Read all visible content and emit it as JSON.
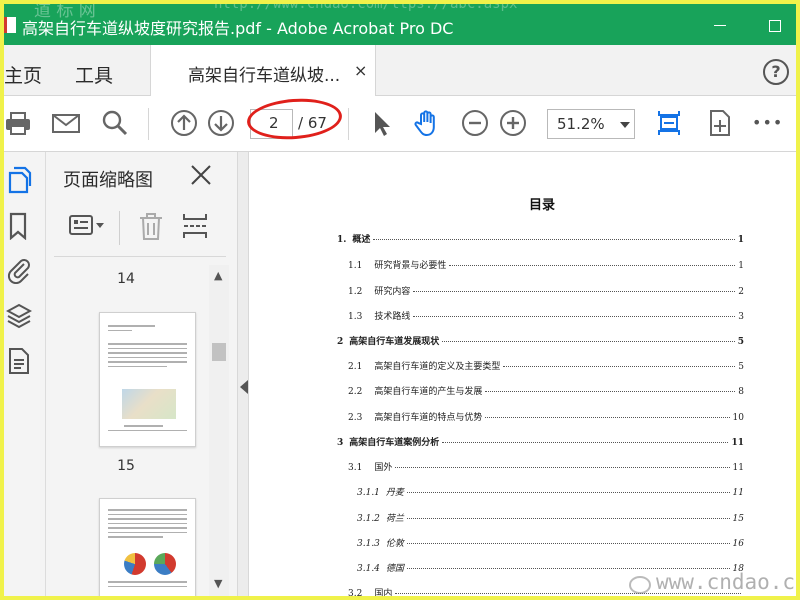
{
  "window": {
    "title": "高架自行车道纵坡度研究报告.pdf - Adobe Acrobat Pro DC",
    "watermark_top": "道 标 网",
    "watermark_top_url": "http://www.cndao.com/ttps://abc.aspx",
    "titlebar_color": "#18a35a"
  },
  "tabs": {
    "home": "主页",
    "tools": "工具",
    "document": "高架自行车道纵坡...",
    "close": "×"
  },
  "help": {
    "label": "?"
  },
  "toolbar": {
    "page_current": "2",
    "page_total": "/ 67",
    "zoom": "51.2%",
    "icons": [
      "print-icon",
      "email-icon",
      "search-icon",
      "previous-page-icon",
      "next-page-icon",
      "select-arrow-icon",
      "hand-tool-icon",
      "zoom-out-icon",
      "zoom-in-icon",
      "fit-page-icon",
      "scroll-mode-icon",
      "more-icon"
    ],
    "more_label": "•••",
    "accent": "#1473e6",
    "highlight_color": "#e0201b"
  },
  "rail": {
    "icons": [
      "page-thumbnails-icon",
      "bookmarks-icon",
      "attachments-icon",
      "layers-icon",
      "document-info-icon"
    ]
  },
  "thumbnails_panel": {
    "title": "页面缩略图",
    "close": "✕",
    "icons": [
      "thumbnail-options-icon",
      "delete-page-icon",
      "insert-page-icon"
    ],
    "pages": [
      {
        "label": "14"
      },
      {
        "label": "15"
      }
    ]
  },
  "document": {
    "toc_title": "目录",
    "toc": [
      {
        "num": "1.",
        "text": "概述",
        "page": "1",
        "level": 1
      },
      {
        "num": "1.1",
        "text": "研究背景与必要性",
        "page": "1",
        "level": 2
      },
      {
        "num": "1.2",
        "text": "研究内容",
        "page": "2",
        "level": 2
      },
      {
        "num": "1.3",
        "text": "技术路线",
        "page": "3",
        "level": 2
      },
      {
        "num": "2",
        "text": "高架自行车道发展现状",
        "page": "5",
        "level": 1
      },
      {
        "num": "2.1",
        "text": "高架自行车道的定义及主要类型",
        "page": "5",
        "level": 2
      },
      {
        "num": "2.2",
        "text": "高架自行车道的产生与发展",
        "page": "8",
        "level": 2
      },
      {
        "num": "2.3",
        "text": "高架自行车道的特点与优势",
        "page": "10",
        "level": 2
      },
      {
        "num": "3",
        "text": "高架自行车道案例分析",
        "page": "11",
        "level": 1
      },
      {
        "num": "3.1",
        "text": "国外",
        "page": "11",
        "level": 2
      },
      {
        "num": "3.1.1",
        "text": "丹麦",
        "page": "11",
        "level": 3
      },
      {
        "num": "3.1.2",
        "text": "荷兰",
        "page": "15",
        "level": 3
      },
      {
        "num": "3.1.3",
        "text": "伦敦",
        "page": "16",
        "level": 3
      },
      {
        "num": "3.1.4",
        "text": "德国",
        "page": "18",
        "level": 3
      },
      {
        "num": "3.2",
        "text": "国内",
        "page": "",
        "level": 2
      }
    ]
  },
  "watermark_bottom": "www.cndao.com"
}
